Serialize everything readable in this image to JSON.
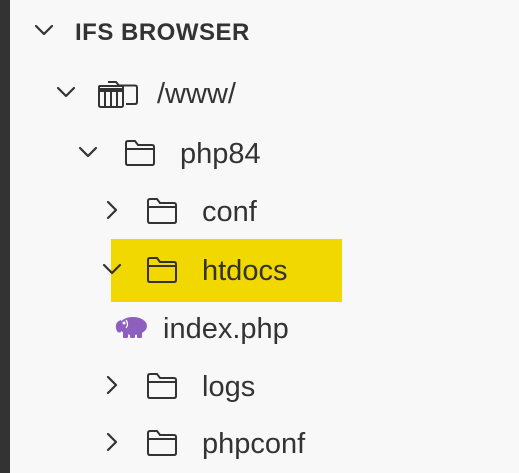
{
  "colors": {
    "background": "#f8f8f8",
    "left_bar": "#333333",
    "text": "#333333",
    "highlight": "#f0d800",
    "php_icon": "#8f5fc0"
  },
  "explorer": {
    "header": {
      "label": "IFS BROWSER",
      "chevron": "chevron-down-icon"
    },
    "tree": [
      {
        "label": "/www/",
        "icon": "archive-folder-icon",
        "chevron": "chevron-down-icon",
        "level": 1,
        "expanded": true
      },
      {
        "label": "php84",
        "icon": "folder-icon",
        "chevron": "chevron-down-icon",
        "level": 2,
        "expanded": true
      },
      {
        "label": "conf",
        "icon": "folder-icon",
        "chevron": "chevron-right-icon",
        "level": 3,
        "expanded": false
      },
      {
        "label": "htdocs",
        "icon": "folder-icon",
        "chevron": "chevron-down-icon",
        "level": 3,
        "expanded": true,
        "highlighted": true
      },
      {
        "label": "index.php",
        "icon": "php-elephant-icon",
        "level": 4
      },
      {
        "label": "logs",
        "icon": "folder-icon",
        "chevron": "chevron-right-icon",
        "level": 3,
        "expanded": false
      },
      {
        "label": "phpconf",
        "icon": "folder-icon",
        "chevron": "chevron-right-icon",
        "level": 3,
        "expanded": false
      }
    ]
  }
}
